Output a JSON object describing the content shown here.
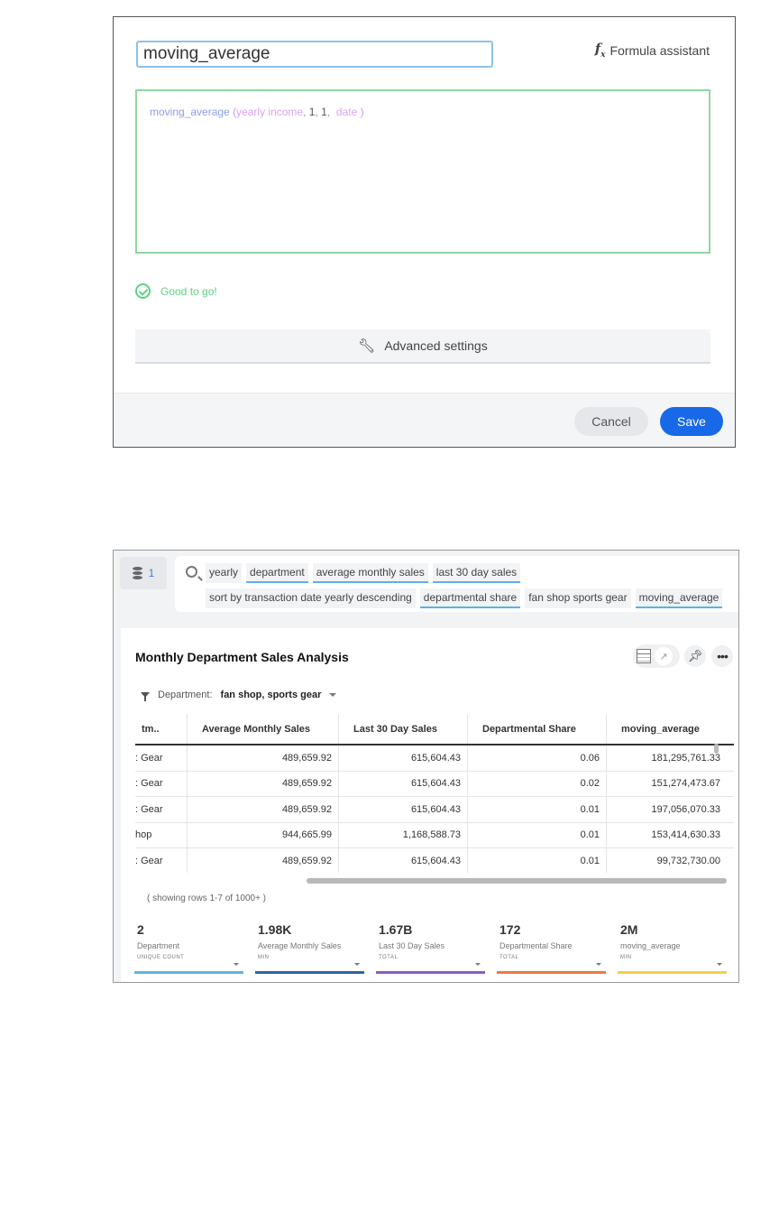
{
  "formula_editor": {
    "name_value": "moving_average",
    "assistant_label": "Formula assistant",
    "formula": {
      "function": "moving_average",
      "open_paren": "(",
      "column": "yearly income",
      "arg1": "1",
      "arg2": "1",
      "date_arg": "date",
      "close_paren": ")",
      "sep": ","
    },
    "status": "Good to go!",
    "advanced_label": "Advanced settings",
    "cancel_label": "Cancel",
    "save_label": "Save",
    "colors": {
      "valid": "#5fd184",
      "save": "#1769e8",
      "function": "#8f9ce8",
      "column": "#d9a2f0"
    }
  },
  "search_panel": {
    "source_count": "1",
    "tokens_row1": [
      {
        "text": "yearly",
        "kind": "keyword"
      },
      {
        "text": "department",
        "kind": "column"
      },
      {
        "text": "average monthly sales",
        "kind": "column"
      },
      {
        "text": "last 30 day sales",
        "kind": "column"
      }
    ],
    "tokens_row2": [
      {
        "text": "sort by transaction date yearly descending",
        "kind": "keyword"
      },
      {
        "text": "departmental share",
        "kind": "column"
      },
      {
        "text": "fan shop sports gear",
        "kind": "keyword"
      },
      {
        "text": "moving_average",
        "kind": "column"
      }
    ]
  },
  "answer": {
    "title": "Monthly Department Sales Analysis",
    "filter": {
      "label": "Department:",
      "value": "fan shop, sports gear"
    },
    "table": {
      "columns": [
        "tm..",
        "Average Monthly Sales",
        "Last 30 Day Sales",
        "Departmental Share",
        "moving_average"
      ],
      "rows": [
        [
          ": Gear",
          "489,659.92",
          "615,604.43",
          "0.06",
          "181,295,761.33"
        ],
        [
          ": Gear",
          "489,659.92",
          "615,604.43",
          "0.02",
          "151,274,473.67"
        ],
        [
          ": Gear",
          "489,659.92",
          "615,604.43",
          "0.01",
          "197,056,070.33"
        ],
        [
          "hop",
          "944,665.99",
          "1,168,588.73",
          "0.01",
          "153,414,630.33"
        ],
        [
          ": Gear",
          "489,659.92",
          "615,604.43",
          "0.01",
          "99,732,730.00"
        ]
      ]
    },
    "rows_note": "( showing rows 1-7 of 1000+ )",
    "summaries": [
      {
        "value": "2",
        "label": "Department",
        "agg": "UNIQUE COUNT",
        "color": "#5fb3e6"
      },
      {
        "value": "1.98K",
        "label": "Average Monthly Sales",
        "agg": "MIN",
        "color": "#2f62a6"
      },
      {
        "value": "1.67B",
        "label": "Last 30 Day Sales",
        "agg": "TOTAL",
        "color": "#8a5bc7"
      },
      {
        "value": "172",
        "label": "Departmental Share",
        "agg": "TOTAL",
        "color": "#f07a3c"
      },
      {
        "value": "2M",
        "label": "moving_average",
        "agg": "MIN",
        "color": "#f5cf4a"
      }
    ]
  }
}
